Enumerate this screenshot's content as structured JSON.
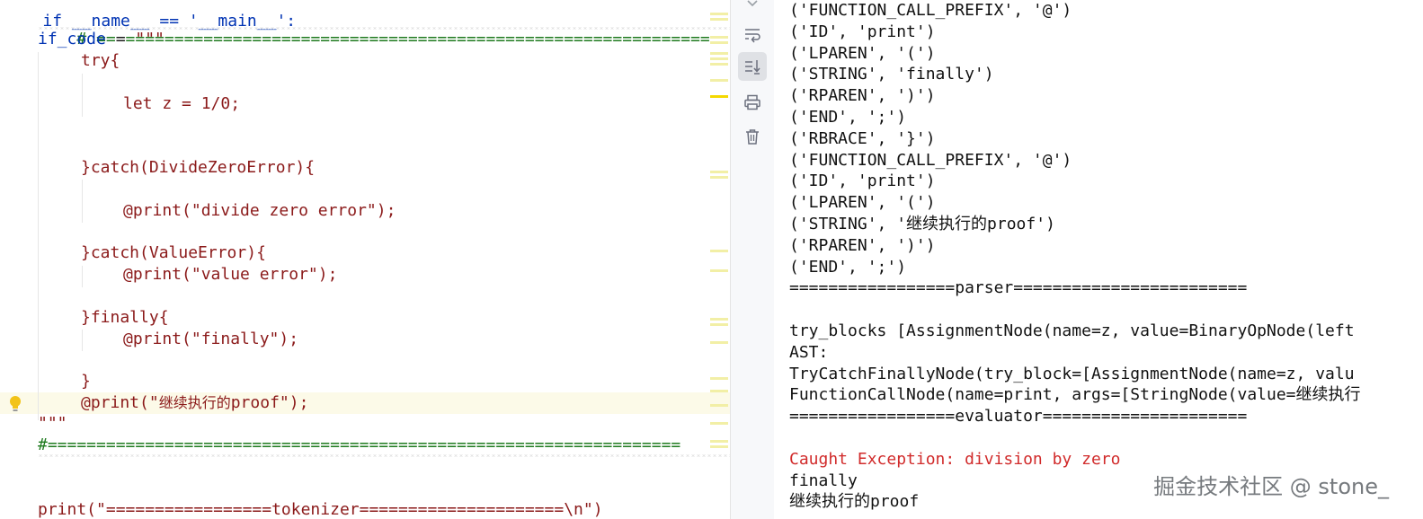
{
  "editor": {
    "top_partial": "if __name__ == '__main__':",
    "lines": {
      "sep_comment": "# ===============================================================",
      "if_code_name": "if_code",
      "if_code_eq": " = ",
      "if_code_open": "\"\"\"",
      "try_open": "try{",
      "let_stmt": "let z = 1/0;",
      "catch_divide": "}catch(DivideZeroError){",
      "print_divide": "@print(\"divide zero error\");",
      "catch_value": "}catch(ValueError){",
      "print_value": "@print(\"value error\");",
      "finally_open": "}finally{",
      "print_finally": "@print(\"finally\");",
      "close_brace": "}",
      "print_proof_pre": "@print(\"",
      "print_proof_cjk": "继续执行的",
      "print_proof_post": "proof\");",
      "close_triple": "\"\"\"",
      "hash_sep": "#=================================================================",
      "print_tokenizer": "print(\"=================tokenizer=====================\\n\")"
    }
  },
  "toolstrip": {
    "buttons": [
      "scroll-up-icon",
      "soft-wrap-icon",
      "scroll-to-end-icon",
      "print-icon",
      "trash-icon"
    ]
  },
  "console": {
    "lines": [
      "('FUNCTION_CALL_PREFIX', '@')",
      "('ID', 'print')",
      "('LPAREN', '(')",
      "('STRING', 'finally')",
      "('RPAREN', ')')",
      "('END', ';')",
      "('RBRACE', '}')",
      "('FUNCTION_CALL_PREFIX', '@')",
      "('ID', 'print')",
      "('LPAREN', '(')",
      "('STRING', '继续执行的proof')",
      "('RPAREN', ')')",
      "('END', ';')",
      "=================parser========================",
      "",
      "try_blocks [AssignmentNode(name=z, value=BinaryOpNode(left",
      "AST:",
      "TryCatchFinallyNode(try_block=[AssignmentNode(name=z, valu",
      "FunctionCallNode(name=print, args=[StringNode(value=继续执行",
      "=================evaluator=====================",
      "",
      "Caught Exception: division by zero",
      "finally",
      "继续执行的proof"
    ],
    "error_line_index": 21,
    "watermark": "掘金技术社区 @ stone_"
  }
}
